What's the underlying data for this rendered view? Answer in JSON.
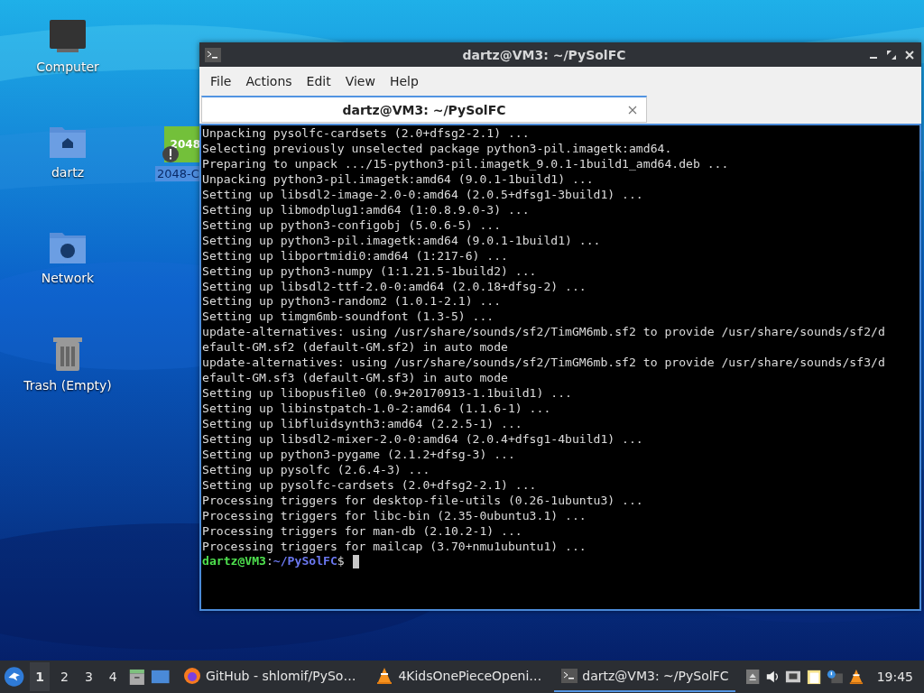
{
  "desktop_icons": [
    {
      "label": "Computer",
      "kind": "computer"
    },
    {
      "label": "dartz",
      "kind": "home"
    },
    {
      "label": "Network",
      "kind": "network"
    },
    {
      "label": "Trash (Empty)",
      "kind": "trash"
    }
  ],
  "file_icon": {
    "badge": "2048",
    "label": "2048-C",
    "selected": true
  },
  "window": {
    "title": "dartz@VM3: ~/PySolFC",
    "menu": [
      "File",
      "Actions",
      "Edit",
      "View",
      "Help"
    ],
    "tabs": [
      {
        "label": "dartz@VM3: ~/PySolFC",
        "selected": true
      }
    ],
    "lines": [
      "Unpacking pysolfc-cardsets (2.0+dfsg2-2.1) ...",
      "Selecting previously unselected package python3-pil.imagetk:amd64.",
      "Preparing to unpack .../15-python3-pil.imagetk_9.0.1-1build1_amd64.deb ...",
      "Unpacking python3-pil.imagetk:amd64 (9.0.1-1build1) ...",
      "Setting up libsdl2-image-2.0-0:amd64 (2.0.5+dfsg1-3build1) ...",
      "Setting up libmodplug1:amd64 (1:0.8.9.0-3) ...",
      "Setting up python3-configobj (5.0.6-5) ...",
      "Setting up python3-pil.imagetk:amd64 (9.0.1-1build1) ...",
      "Setting up libportmidi0:amd64 (1:217-6) ...",
      "Setting up python3-numpy (1:1.21.5-1build2) ...",
      "Setting up libsdl2-ttf-2.0-0:amd64 (2.0.18+dfsg-2) ...",
      "Setting up python3-random2 (1.0.1-2.1) ...",
      "Setting up timgm6mb-soundfont (1.3-5) ...",
      "update-alternatives: using /usr/share/sounds/sf2/TimGM6mb.sf2 to provide /usr/share/sounds/sf2/d",
      "efault-GM.sf2 (default-GM.sf2) in auto mode",
      "update-alternatives: using /usr/share/sounds/sf2/TimGM6mb.sf2 to provide /usr/share/sounds/sf3/d",
      "efault-GM.sf3 (default-GM.sf3) in auto mode",
      "Setting up libopusfile0 (0.9+20170913-1.1build1) ...",
      "Setting up libinstpatch-1.0-2:amd64 (1.1.6-1) ...",
      "Setting up libfluidsynth3:amd64 (2.2.5-1) ...",
      "Setting up libsdl2-mixer-2.0-0:amd64 (2.0.4+dfsg1-4build1) ...",
      "Setting up python3-pygame (2.1.2+dfsg-3) ...",
      "Setting up pysolfc (2.6.4-3) ...",
      "Setting up pysolfc-cardsets (2.0+dfsg2-2.1) ...",
      "Processing triggers for desktop-file-utils (0.26-1ubuntu3) ...",
      "Processing triggers for libc-bin (2.35-0ubuntu3.1) ...",
      "Processing triggers for man-db (2.10.2-1) ...",
      "Processing triggers for mailcap (3.70+nmu1ubuntu1) ..."
    ],
    "prompt": {
      "user_host": "dartz@VM3",
      "separator": ":",
      "path": "~/PySolFC",
      "symbol": "$"
    }
  },
  "taskbar": {
    "workspaces": [
      {
        "label": "1",
        "selected": true
      },
      {
        "label": "2",
        "selected": false
      },
      {
        "label": "3",
        "selected": false
      },
      {
        "label": "4",
        "selected": false
      }
    ],
    "tasks": [
      {
        "kind": "browser",
        "label": "GitHub - shlomif/PySo…",
        "selected": false
      },
      {
        "kind": "media",
        "label": "4KidsOnePieceOpeni…",
        "selected": false
      },
      {
        "kind": "terminal",
        "label": "dartz@VM3: ~/PySolFC",
        "selected": true
      }
    ],
    "clock": "19:45"
  }
}
